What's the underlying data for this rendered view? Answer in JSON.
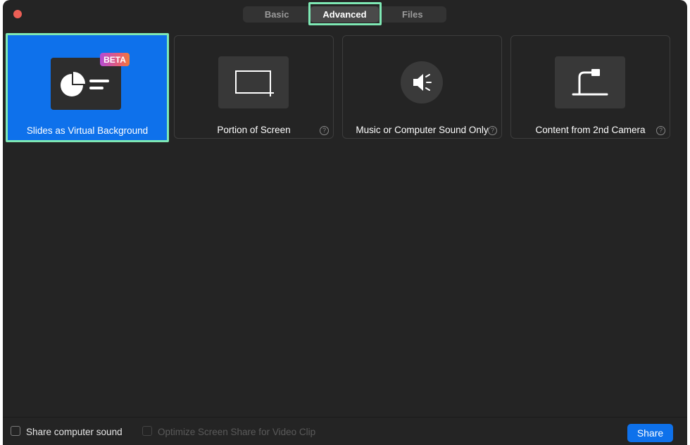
{
  "tabs": {
    "basic": "Basic",
    "advanced": "Advanced",
    "files": "Files",
    "active": "Advanced"
  },
  "cards": [
    {
      "label": "Slides as Virtual Background",
      "badge": "BETA",
      "icon": "slides-background-icon",
      "selected": true
    },
    {
      "label": "Portion of Screen",
      "icon": "portion-of-screen-icon",
      "help": "?"
    },
    {
      "label": "Music or Computer Sound Only",
      "icon": "speaker-icon",
      "help": "?"
    },
    {
      "label": "Content from 2nd Camera",
      "icon": "document-camera-icon",
      "help": "?"
    }
  ],
  "footer": {
    "share_sound_label": "Share computer sound",
    "optimize_label": "Optimize Screen Share for Video Clip",
    "share_button": "Share"
  },
  "colors": {
    "background": "#242424",
    "accent_blue": "#0e71eb",
    "highlight_green": "#7ee8b4",
    "close_red": "#ec5f56"
  }
}
